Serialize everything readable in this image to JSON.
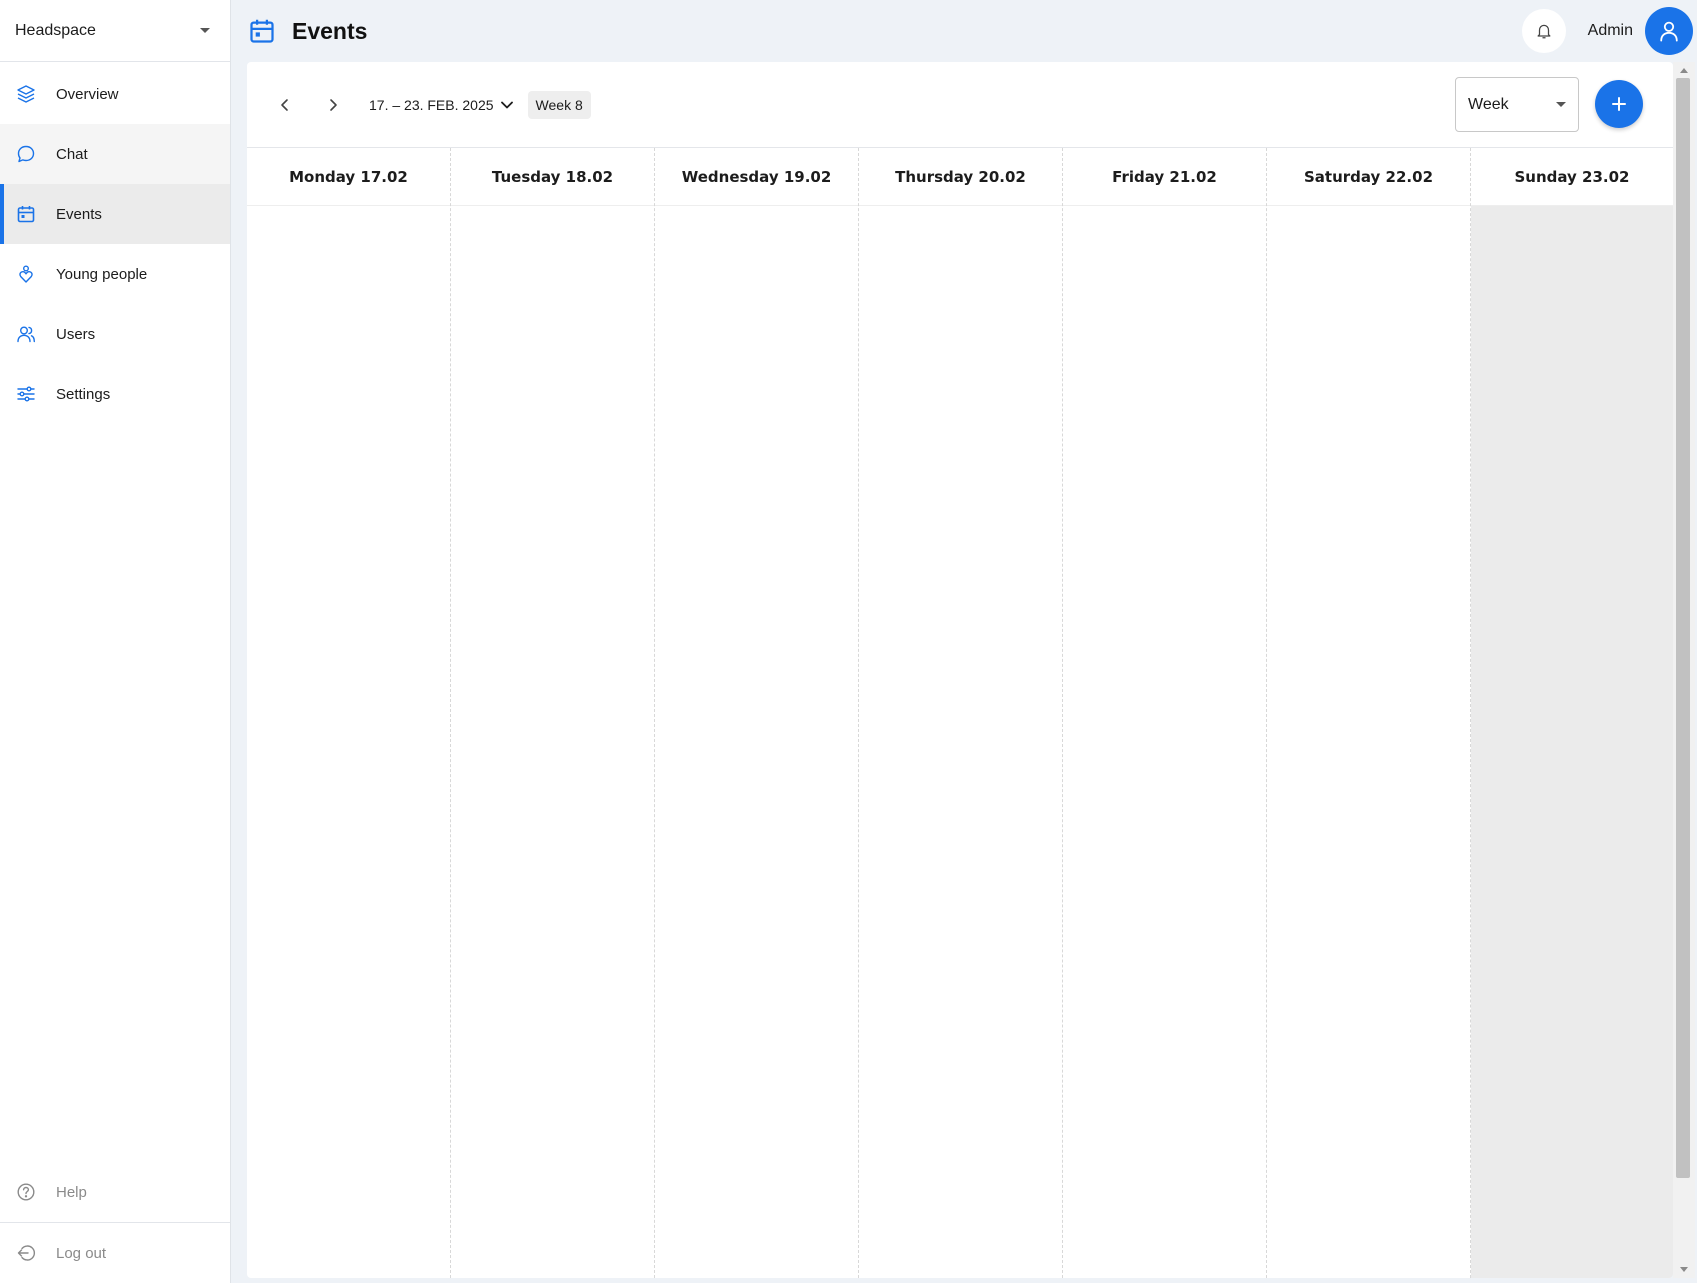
{
  "sidebar": {
    "org_name": "Headspace",
    "items": [
      {
        "label": "Overview",
        "icon": "layers-icon"
      },
      {
        "label": "Chat",
        "icon": "chat-bubble-icon"
      },
      {
        "label": "Events",
        "icon": "calendar-icon"
      },
      {
        "label": "Young people",
        "icon": "person-heart-icon"
      },
      {
        "label": "Users",
        "icon": "users-icon"
      },
      {
        "label": "Settings",
        "icon": "sliders-icon"
      }
    ],
    "active_item": "Events",
    "bottom": {
      "help_label": "Help",
      "logout_label": "Log out"
    }
  },
  "header": {
    "title": "Events",
    "user_name": "Admin"
  },
  "toolbar": {
    "date_range": "17. – 23. FEB. 2025",
    "week_label": "Week 8",
    "view_value": "Week"
  },
  "calendar": {
    "days": [
      "Monday 17.02",
      "Tuesday 18.02",
      "Wednesday 19.02",
      "Thursday 20.02",
      "Friday 21.02",
      "Saturday 22.02",
      "Sunday 23.02"
    ]
  },
  "colors": {
    "accent": "#1a73e8",
    "weekend_fill": "#ebebeb",
    "page_background": "#eef2f7"
  }
}
